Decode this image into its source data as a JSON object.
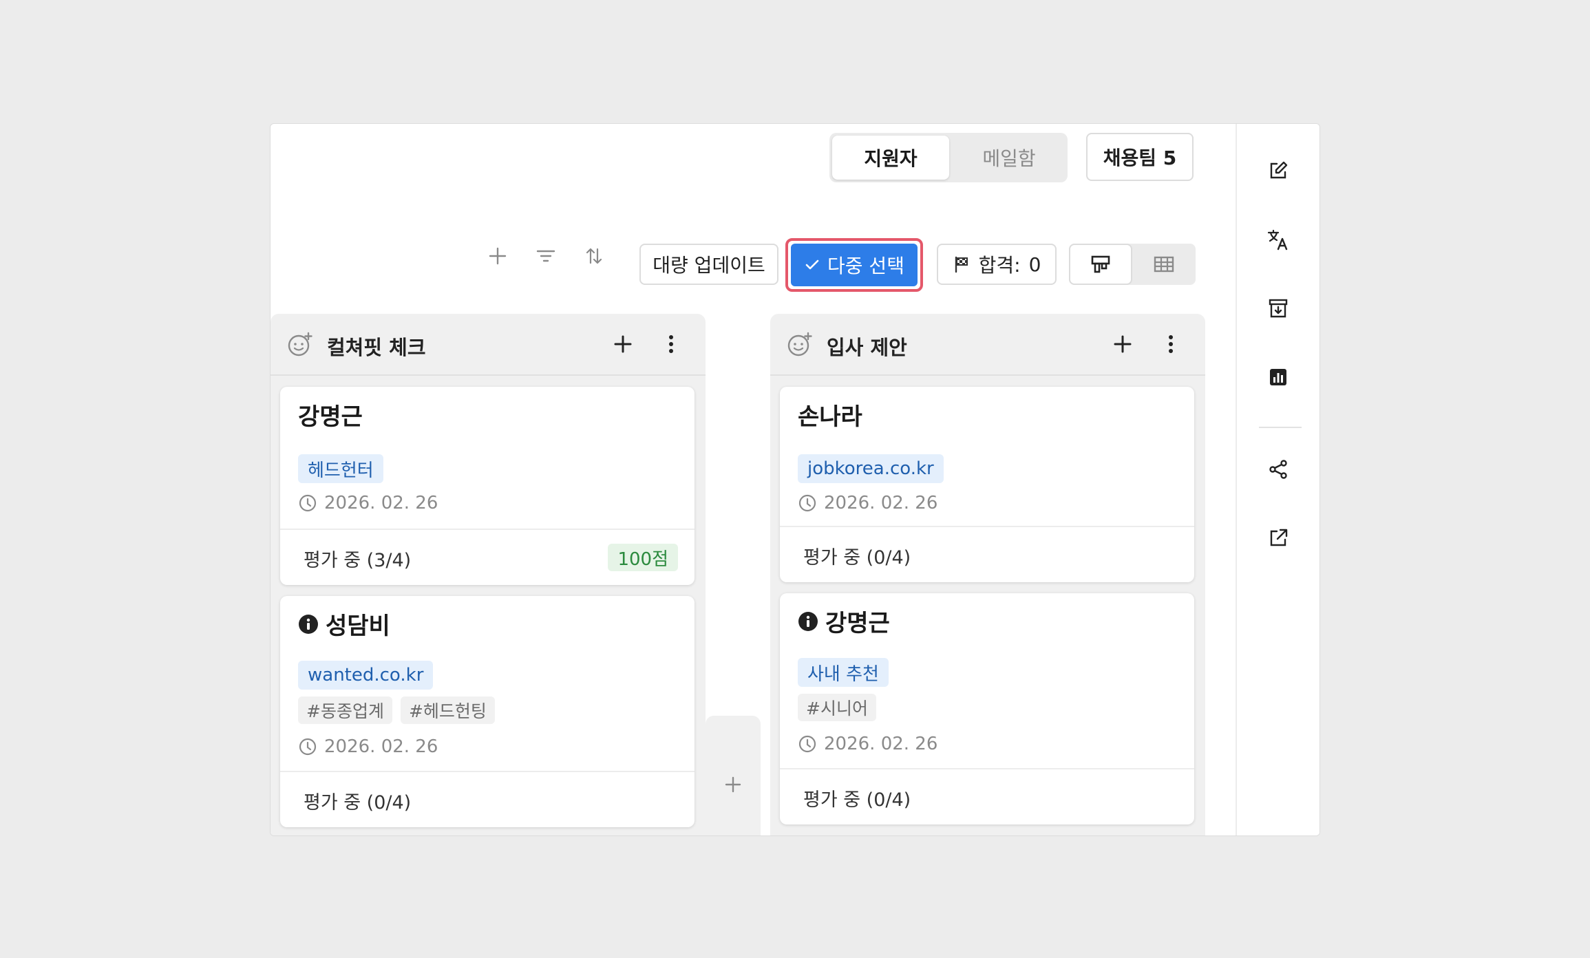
{
  "header": {
    "tabs": [
      {
        "label": "지원자",
        "active": true
      },
      {
        "label": "메일함",
        "active": false
      }
    ],
    "team_button": "채용팀 5"
  },
  "toolbar": {
    "add_icon": "plus-icon",
    "filter_icon": "filter-icon",
    "sort_icon": "sort-icon",
    "bulk_update_label": "대량 업데이트",
    "multi_select_label": "다중 선택",
    "pass_label": "합격:",
    "pass_count": "0",
    "view_modes": [
      "board-view",
      "table-view"
    ],
    "accent_color": "#2d7de8",
    "highlight_color": "#e4586a"
  },
  "columns": [
    {
      "title": "컬쳐핏 체크",
      "cards": [
        {
          "name": "강명근",
          "source": "헤드헌터",
          "tags": [],
          "date": "2026. 02. 26",
          "status": "평가 중 (3/4)",
          "score": "100점",
          "warning": false
        },
        {
          "name": "성담비",
          "source": "wanted.co.kr",
          "tags": [
            "#동종업계",
            "#헤드헌팅"
          ],
          "date": "2026. 02. 26",
          "status": "평가 중 (0/4)",
          "score": "",
          "warning": true
        }
      ]
    },
    {
      "title": "입사 제안",
      "cards": [
        {
          "name": "손나라",
          "source": "jobkorea.co.kr",
          "tags": [],
          "date": "2026. 02. 26",
          "status": "평가 중 (0/4)",
          "score": "",
          "warning": false
        },
        {
          "name": "강명근",
          "source": "사내 추천",
          "tags": [
            "#시니어"
          ],
          "date": "2026. 02. 26",
          "status": "평가 중 (0/4)",
          "score": "",
          "warning": true
        }
      ]
    }
  ],
  "sidebar_icons": [
    "edit-icon",
    "translate-icon",
    "archive-icon",
    "chart-icon",
    "share-icon",
    "external-link-icon"
  ]
}
